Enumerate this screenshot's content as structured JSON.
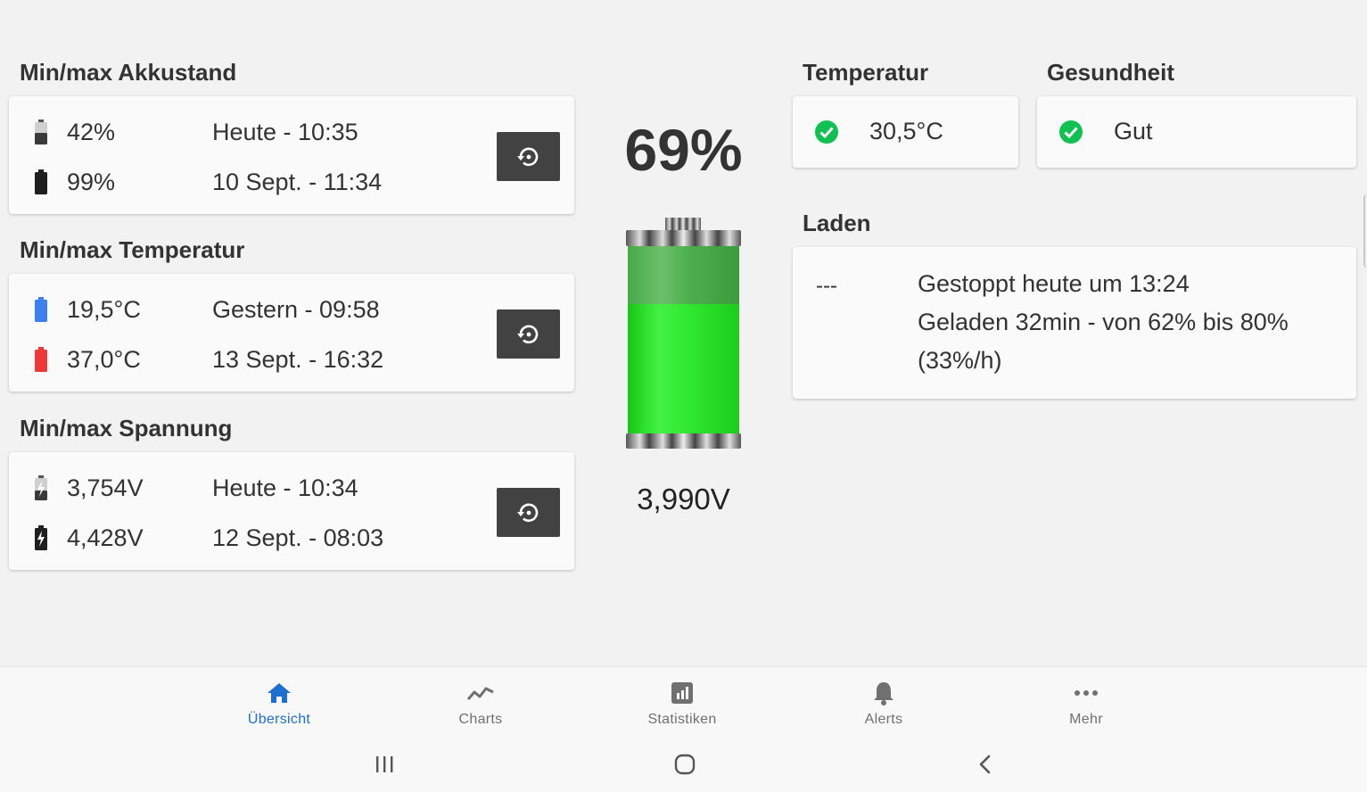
{
  "akkustand": {
    "title": "Min/max Akkustand",
    "min": {
      "value": "42%",
      "when": "Heute - 10:35"
    },
    "max": {
      "value": "99%",
      "when": "10 Sept. - 11:34"
    }
  },
  "temperatur_minmax": {
    "title": "Min/max Temperatur",
    "min": {
      "value": "19,5°C",
      "when": "Gestern - 09:58"
    },
    "max": {
      "value": "37,0°C",
      "when": "13 Sept. - 16:32"
    }
  },
  "spannung": {
    "title": "Min/max Spannung",
    "min": {
      "value": "3,754V",
      "when": "Heute - 10:34"
    },
    "max": {
      "value": "4,428V",
      "when": "12 Sept. - 08:03"
    }
  },
  "battery": {
    "percent_label": "69%",
    "level": 0.69,
    "voltage": "3,990V",
    "fill_color": "#33ee33"
  },
  "temperatur": {
    "title": "Temperatur",
    "value": "30,5°C"
  },
  "gesundheit": {
    "title": "Gesundheit",
    "value": "Gut"
  },
  "laden": {
    "title": "Laden",
    "status_dash": "---",
    "line1": "Gestoppt heute um 13:24",
    "line2": "Geladen 32min - von 62% bis 80%",
    "line3": "(33%/h)"
  },
  "nav": {
    "items": [
      {
        "label": "Übersicht",
        "icon": "home-icon"
      },
      {
        "label": "Charts",
        "icon": "chart-line-icon"
      },
      {
        "label": "Statistiken",
        "icon": "statistics-icon"
      },
      {
        "label": "Alerts",
        "icon": "bell-icon"
      },
      {
        "label": "Mehr",
        "icon": "more-icon"
      }
    ],
    "active_color": "#1e6fd0"
  },
  "colors": {
    "ok_green": "#10c050",
    "temp_min_blue": "#3b7ff0",
    "temp_max_red": "#f03838",
    "button_dark": "#424242"
  }
}
